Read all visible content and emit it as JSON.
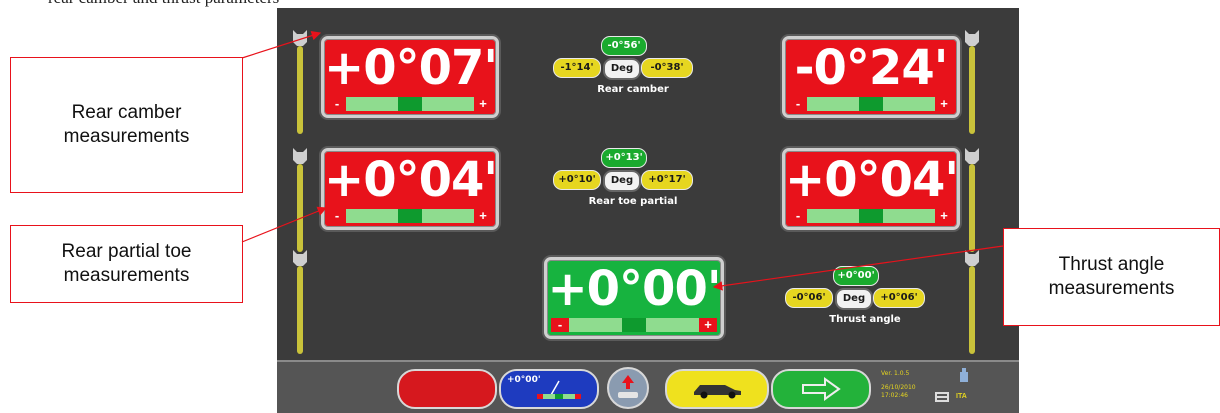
{
  "caption_fragment": "rear camber and thrust parameters",
  "measurements": {
    "rear_camber_left": "+0°07'",
    "rear_camber_right": "-0°24'",
    "rear_toe_left": "+0°04'",
    "rear_toe_right": "+0°04'",
    "thrust_angle": "+0°00'"
  },
  "scale_signs": {
    "minus": "-",
    "plus": "+"
  },
  "tolerances": {
    "rear_camber": {
      "nominal": "-0°56'",
      "min": "-1°14'",
      "max": "-0°38'",
      "unit": "Deg",
      "label": "Rear camber"
    },
    "rear_toe_partial": {
      "nominal": "+0°13'",
      "min": "+0°10'",
      "max": "+0°17'",
      "unit": "Deg",
      "label": "Rear toe partial"
    },
    "thrust_angle": {
      "nominal": "+0°00'",
      "min": "-0°06'",
      "max": "+0°06'",
      "unit": "Deg",
      "label": "Thrust angle"
    }
  },
  "bottom_bar": {
    "zero_button_label": "+0°00'",
    "version": "Ver. 1.0.5",
    "date": "26/10/2010",
    "time": "17:02:46",
    "language": "ITA"
  },
  "callouts": {
    "rear_camber": {
      "line1": "Rear camber",
      "line2": "measurements"
    },
    "rear_partial_toe": {
      "line1": "Rear partial toe",
      "line2": "measurements"
    },
    "thrust_angle": {
      "line1": "Thrust angle",
      "line2": "measurements"
    }
  },
  "colors": {
    "out_of_tolerance": "#e8121b",
    "in_tolerance": "#17b33f",
    "screen_background": "#3b3b3b",
    "callout_border": "#e8121b"
  }
}
